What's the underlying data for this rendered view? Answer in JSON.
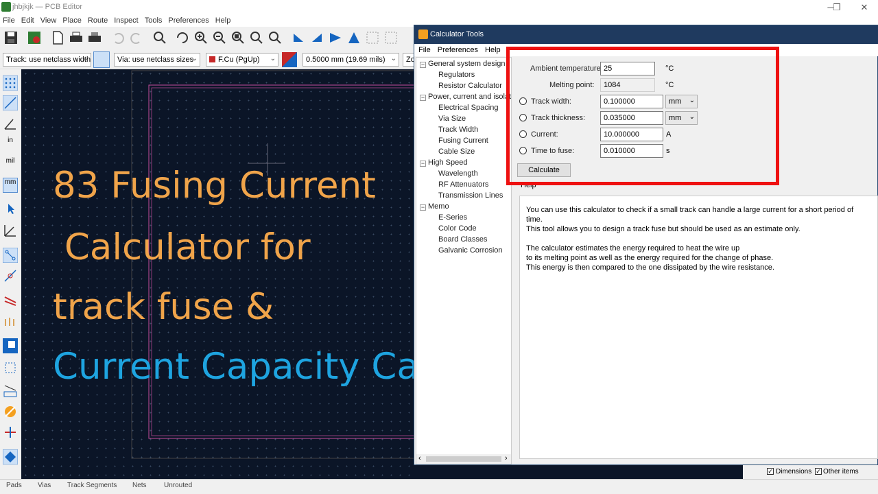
{
  "window": {
    "title": "jhbjkjk — PCB Editor"
  },
  "menu": [
    "File",
    "Edit",
    "View",
    "Place",
    "Route",
    "Inspect",
    "Tools",
    "Preferences",
    "Help"
  ],
  "options_bar": {
    "track_width": "Track: use netclass width",
    "via_size": "Via: use netclass sizes",
    "layer": "F.Cu (PgUp)",
    "grid": "0.5000 mm (19.69 mils)",
    "zoom": "Zo"
  },
  "left_toolbar": {
    "in_label": "in",
    "mil_label": "mil",
    "mm_label": "mm"
  },
  "overlay": {
    "line1": "83 Fusing Current",
    "line2": " Calculator for",
    "line3": "track fuse &",
    "line4": "Current Capacity Calculator"
  },
  "calculator": {
    "title": "Calculator Tools",
    "menu": [
      "File",
      "Preferences",
      "Help"
    ],
    "tree": [
      {
        "label": "General system design",
        "children": [
          "Regulators",
          "Resistor Calculator"
        ]
      },
      {
        "label": "Power, current and isolation",
        "children": [
          "Electrical Spacing",
          "Via Size",
          "Track Width",
          "Fusing Current",
          "Cable Size"
        ]
      },
      {
        "label": "High Speed",
        "children": [
          "Wavelength",
          "RF Attenuators",
          "Transmission Lines"
        ]
      },
      {
        "label": "Memo",
        "children": [
          "E-Series",
          "Color Code",
          "Board Classes",
          "Galvanic Corrosion"
        ]
      }
    ],
    "fields": {
      "ambient_label": "Ambient temperature:",
      "ambient_value": "25",
      "ambient_unit": "°C",
      "melting_label": "Melting point:",
      "melting_value": "1084",
      "melting_unit": "°C",
      "width_label": "Track width:",
      "width_value": "0.100000",
      "width_unit": "mm",
      "thickness_label": "Track thickness:",
      "thickness_value": "0.035000",
      "thickness_unit": "mm",
      "current_label": "Current:",
      "current_value": "10.000000",
      "current_unit": "A",
      "time_label": "Time to fuse:",
      "time_value": "0.010000",
      "time_unit": "s"
    },
    "calculate_button": "Calculate",
    "help_title": "Help",
    "help_p1_l1": "You can use this calculator to check if a small track can handle a large current for a short period of time.",
    "help_p1_l2": "This tool allows you to design a track fuse but should be used as an estimate only.",
    "help_p2_l1": "The calculator estimates the energy required to heat the wire up",
    "help_p2_l2": "to its melting point as well as the energy required for the change of phase.",
    "help_p2_l3": "This energy is then compared to the one dissipated by the wire resistance."
  },
  "right_panel": {
    "dimensions": "Dimensions",
    "other_items": "Other items"
  },
  "status": {
    "pads": "Pads",
    "vias": "Vias",
    "track_segments": "Track Segments",
    "nets": "Nets",
    "unrouted": "Unrouted"
  },
  "colors": {
    "canvas": "#0b1527",
    "board_edge": "#c64d9c",
    "overlay_orange": "#f0a44a",
    "overlay_blue": "#1ea4e0",
    "highlight_red": "#e11111",
    "calc_title_bar": "#1f3a5f"
  }
}
